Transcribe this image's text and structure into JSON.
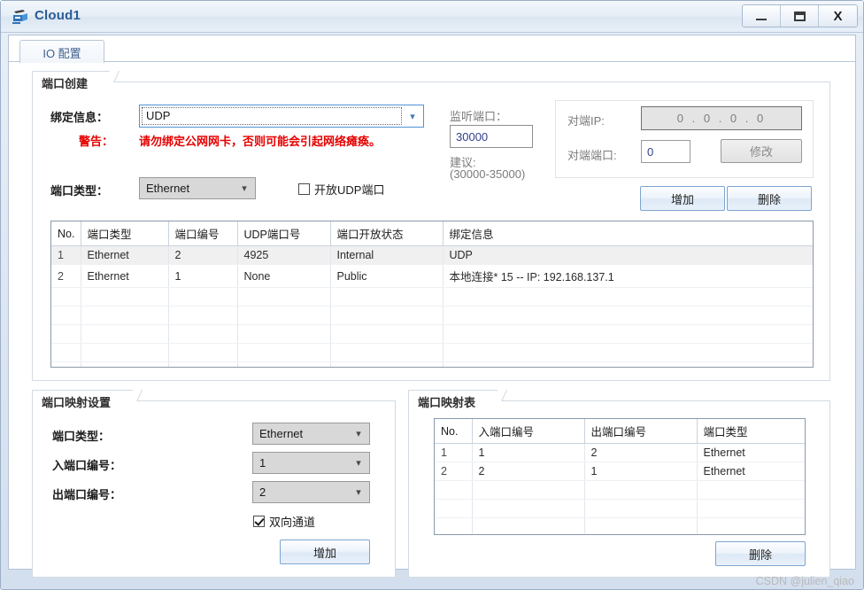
{
  "window": {
    "title": "Cloud1",
    "icon": "cloud-device-icon",
    "minimize_label": "–",
    "maximize_label": "❐",
    "close_label": "X"
  },
  "tabs": [
    {
      "label": "IO 配置",
      "active": true
    }
  ],
  "port_create": {
    "title": "端口创建",
    "binding_label": "绑定信息：",
    "binding_value": "UDP",
    "warning_label": "警告：",
    "warning_text": "请勿绑定公网网卡，否则可能会引起网络瘫痪。",
    "port_type_label": "端口类型：",
    "port_type_value": "Ethernet",
    "open_udp_label": "开放UDP端口",
    "open_udp_checked": false,
    "listen_port_label": "监听端口：",
    "listen_port_value": "30000",
    "suggest_label": "建议:",
    "suggest_range": "(30000-35000)",
    "peer_ip_label": "对端IP:",
    "peer_ip_value": "0 . 0 . 0 . 0",
    "peer_port_label": "对端端口:",
    "peer_port_value": "0",
    "modify_button": "修改",
    "add_button": "增加",
    "delete_button": "删除"
  },
  "port_table": {
    "headers": [
      "No.",
      "端口类型",
      "端口编号",
      "UDP端口号",
      "端口开放状态",
      "绑定信息"
    ],
    "rows": [
      {
        "no": "1",
        "type": "Ethernet",
        "port_no": "2",
        "udp_port": "4925",
        "state": "Internal",
        "binding": "UDP",
        "selected": true
      },
      {
        "no": "2",
        "type": "Ethernet",
        "port_no": "1",
        "udp_port": "None",
        "state": "Public",
        "binding": "本地连接* 15 -- IP: 192.168.137.1",
        "selected": false
      }
    ],
    "empty_rows": 5
  },
  "mapping_settings": {
    "title": "端口映射设置",
    "port_type_label": "端口类型：",
    "port_type_value": "Ethernet",
    "in_port_label": "入端口编号：",
    "in_port_value": "1",
    "out_port_label": "出端口编号：",
    "out_port_value": "2",
    "bidirectional_label": "双向通道",
    "bidirectional_checked": true,
    "add_button": "增加"
  },
  "mapping_table": {
    "title": "端口映射表",
    "headers": [
      "No.",
      "入端口编号",
      "出端口编号",
      "端口类型"
    ],
    "rows": [
      {
        "no": "1",
        "in_port": "1",
        "out_port": "2",
        "type": "Ethernet"
      },
      {
        "no": "2",
        "in_port": "2",
        "out_port": "1",
        "type": "Ethernet"
      }
    ],
    "empty_rows": 3,
    "delete_button": "删除"
  },
  "watermark": "CSDN @julien_qiao",
  "colors": {
    "title_text": "#2b5b96",
    "warning": "#e60000",
    "accent": "#7da5cf",
    "tab_text": "#40618c"
  }
}
